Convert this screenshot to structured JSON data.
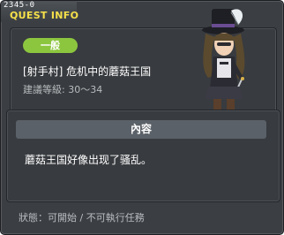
{
  "window": {
    "quest_id": "2345-0",
    "title": "QUEST INFO"
  },
  "quest": {
    "category": "一般",
    "name": "[射手村] 危机中的蘑菇王国",
    "level_label": "建議等級:",
    "level_range": "30～34"
  },
  "content": {
    "header": "內容",
    "text": "蘑菇王国好像出现了骚乱。"
  },
  "status": {
    "text": "狀態：可開始 / 不可執行任務"
  },
  "colors": {
    "title": "#f6e04a",
    "badge": "#8cc63f",
    "window_bg": "#3b3f44"
  },
  "icons": {
    "npc": "npc-character-portrait"
  }
}
